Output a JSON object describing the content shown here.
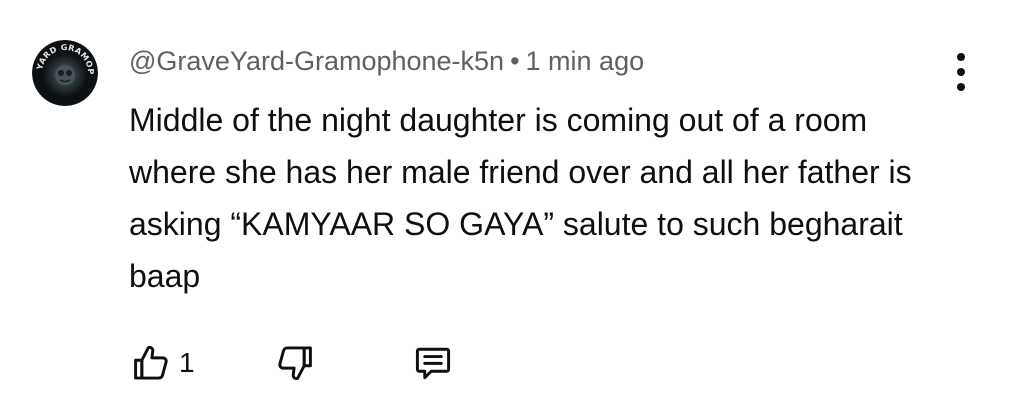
{
  "comment": {
    "author": "@GraveYard-Gramophone-k5n",
    "separator": "•",
    "timestamp": "1 min ago",
    "text": "Middle of the night daughter is coming out of a room where she has her male friend over and all her father is asking “KAMYAAR SO GAYA” salute to such begharait baap",
    "avatar_text": "GRAVEYARD GRAMOPHONE",
    "avatar_icon": "channel-logo",
    "like_count": "1",
    "icons": {
      "like": "thumbs-up-icon",
      "dislike": "thumbs-down-icon",
      "reply": "comment-reply-icon",
      "menu": "more-vertical-icon"
    }
  },
  "colors": {
    "text": "#0f0f0f",
    "meta": "#606060",
    "background": "#ffffff"
  }
}
